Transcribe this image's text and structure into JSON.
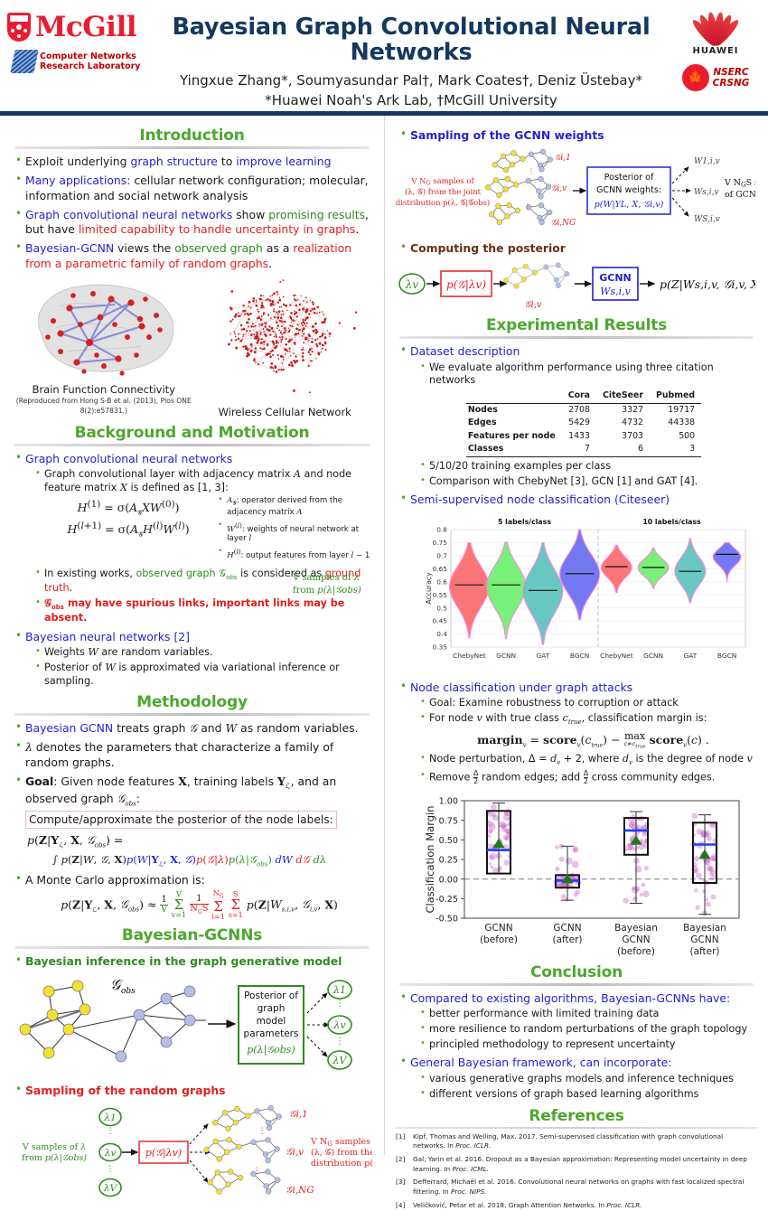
{
  "header": {
    "title": "Bayesian Graph Convolutional Neural Networks",
    "authors": "Yingxue Zhang*, Soumyasundar Pal†, Mark Coates†, Deniz Üstebay*",
    "affiliations": "*Huawei Noah's Ark Lab, †McGill University",
    "logo_mcgill": "McGill",
    "logo_cnrl_line1": "Computer Networks",
    "logo_cnrl_line2": "Research Laboratory",
    "logo_huawei": "HUAWEI",
    "logo_nserc_line1": "NSERC",
    "logo_nserc_line2": "CRSNG"
  },
  "introduction": {
    "heading": "Introduction",
    "bullets": [
      "Exploit underlying graph structure to improve learning",
      "Many applications: cellular network configuration; molecular, information and social network analysis",
      "Graph convolutional neural networks show promising results, but have limited capability to handle uncertainty in graphs.",
      "Bayesian-GCNN views the observed graph as a realization from a parametric family of random graphs."
    ],
    "figure_left_caption": "Brain Function Connectivity",
    "figure_left_subcaption": "(Reproduced from Hong S-B et al. (2013), Plos ONE 8(2):e57831.)",
    "figure_right_caption": "Wireless Cellular Network"
  },
  "background": {
    "heading": "Background and Motivation",
    "b1": "Graph convolutional neural networks",
    "b1s1": "Graph convolutional layer with adjacency matrix A and node feature matrix X is defined as [1, 3]:",
    "eq1": "H(1) = σ(A_G X W(0))",
    "eq2": "H(l+1) = σ(A_G H(l) W(l))",
    "legend": [
      "A_G: operator derived from the adjacency matrix A",
      "W(l): weights of neural network at layer l",
      "H(l): output features from layer l − 1"
    ],
    "b1s2": "In existing works, observed graph G_obs is considered as ground truth.",
    "b1s3": "G_obs may have spurious links, important links may be absent.",
    "b2": "Bayesian neural networks [2]",
    "b2s1": "Weights W are random variables.",
    "b2s2": "Posterior of W is approximated via variational inference or sampling."
  },
  "methodology": {
    "heading": "Methodology",
    "b1": "Bayesian GCNN treats graph G and W as random variables.",
    "b2": "λ denotes the parameters that characterize a family of random graphs.",
    "b3": "Goal: Given node features X, training labels Y_L, and an observed graph G_obs:",
    "notebox": "Compute/approximate the posterior of the node labels:",
    "eq_lhs": "p(Z|Y_L, X, G_obs) =",
    "eq_rhs": "∫ p(Z|W, G, X)p(W|Y_L, X, G)p(G|λ)p(λ|G_obs) dW dG dλ",
    "b4": "A Monte Carlo approximation is:",
    "eq_mc": "p(Z|Y_L, X, G_obs) ≈ (1/V) Σ_{v=1}^{V} (1/(N_G S)) Σ_{i=1}^{N_G} Σ_{s=1}^{S} p(Z|W_{s,i,v}, G_{i,v}, X)"
  },
  "bayesian_gcnns": {
    "heading": "Bayesian-GCNNs",
    "b1": "Bayesian inference in the graph generative model",
    "diagram1": {
      "graph_label": "G_obs",
      "box_lines": [
        "Posterior of",
        "graph",
        "model",
        "parameters",
        "p(λ|G_obs)"
      ],
      "lambda_nodes": [
        "λ1",
        "λv",
        "λV"
      ],
      "right_text_line1": "V samples of λ",
      "right_text_line2": "from p(λ|G_obs)"
    },
    "b2": "Sampling of the random graphs",
    "diagram2": {
      "left_text_line1": "V samples of λ",
      "left_text_line2": "from p(λ|G_obs)",
      "lambda_nodes": [
        "λ1",
        "λv",
        "λV"
      ],
      "box": "p(G|λv)",
      "graph_labels": [
        "G_i,1",
        "G_i,v",
        "G_i,N_G"
      ],
      "right_text_line1": "V N_G samples of",
      "right_text_line2": "(λ, G) from the joint",
      "right_text_line3": "distribution p(λ, G|G_obs)"
    },
    "b3": "Sampling of the GCNN weights",
    "diagram3": {
      "left_text_line1": "V N_G samples of",
      "left_text_line2": "(λ, G) from the joint",
      "left_text_line3": "distribution p(λ, G|G_obs)",
      "graph_labels": [
        "G_i,1",
        "G_i,v",
        "G_i,N_G"
      ],
      "box_lines": [
        "Posterior of",
        "GCNN weights:",
        "p(W|Y_L, X, G_i,v)"
      ],
      "w_labels": [
        "W_1,i,v",
        "W_s,i,v",
        "W_S,i,v"
      ],
      "right_text_line1": "V N_G S samples",
      "right_text_line2": "of GCNN weights"
    },
    "b4": "Computing the posterior",
    "diagram4": {
      "lambda": "λv",
      "box1": "p(G|λv)",
      "graph_label": "G_i,v",
      "box2_line1": "GCNN",
      "box2_line2": "W_s,i,v",
      "output": "p(Z|W_s,i,v, G_i,v, X)"
    }
  },
  "experimental": {
    "heading": "Experimental Results",
    "b1": "Dataset description",
    "b1s1": "We evaluate algorithm performance using three citation networks",
    "b1s2": "5/10/20 training examples per class",
    "b1s3": "Comparison with ChebyNet [3], GCN [1] and GAT [4].",
    "b2": "Semi-supervised node classification (Citeseer)",
    "b3": "Node classification under graph attacks",
    "b3s1": "Goal: Examine robustness to corruption or attack",
    "b3s2": "For node v with true class c_true, classification margin is:",
    "eq_margin": "margin_v = score_v(c_true) − max_{c≠c_true} score_v(c) .",
    "b3s3": "Node perturbation, Δ = d_v + 2, where d_v is the degree of node v",
    "b3s4": "Remove Δ/2 random edges; add Δ/2 cross community edges."
  },
  "dataset_table": {
    "columns": [
      "",
      "Cora",
      "CiteSeer",
      "Pubmed"
    ],
    "rows": [
      {
        "label": "Nodes",
        "values": [
          "2708",
          "3327",
          "19717"
        ]
      },
      {
        "label": "Edges",
        "values": [
          "5429",
          "4732",
          "44338"
        ]
      },
      {
        "label": "Features per node",
        "values": [
          "1433",
          "3703",
          "500"
        ]
      },
      {
        "label": "Classes",
        "values": [
          "7",
          "6",
          "3"
        ]
      }
    ]
  },
  "conclusion": {
    "heading": "Conclusion",
    "b1": "Compared to existing algorithms, Bayesian-GCNNs have:",
    "b1subs": [
      "better performance with limited training data",
      "more resilience to random perturbations of the graph topology",
      "principled methodology to represent uncertainty"
    ],
    "b2": "General Bayesian framework, can incorporate:",
    "b2subs": [
      "various generative graphs models and inference techniques",
      "different versions of graph based learning algorithms"
    ]
  },
  "references": {
    "heading": "References",
    "items": [
      {
        "num": "[1]",
        "text": "Kipf, Thomas and Welling, Max. 2017. Semi-supervised classification with graph convolutional networks. In ",
        "venue": "Proc. ICLR."
      },
      {
        "num": "[2]",
        "text": "Gal, Yarin et al. 2016. Dropout as a Bayesian approximation: Representing model uncertainty in deep learning. In ",
        "venue": "Proc. ICML."
      },
      {
        "num": "[3]",
        "text": "Defferrard, Michaël et al. 2016. Convolutional neural networks on graphs with fast localized spectral filtering. In ",
        "venue": "Proc. NIPS."
      },
      {
        "num": "[4]",
        "text": "Veličković, Petar et al. 2018. Graph Attention Networks. In ",
        "venue": "Proc. ICLR."
      }
    ]
  },
  "chart_data": [
    {
      "type": "violin",
      "title": "Semi-supervised node classification (Citeseer)",
      "ylabel": "Accuracy",
      "xlabel": "",
      "ylim": [
        0.35,
        0.8
      ],
      "yticks": [
        0.35,
        0.4,
        0.45,
        0.5,
        0.55,
        0.6,
        0.65,
        0.7,
        0.75,
        0.8
      ],
      "group_labels": [
        "5 labels/class",
        "10 labels/class"
      ],
      "categories": [
        "ChebyNet",
        "GCNN",
        "GAT",
        "BGCN",
        "ChebyNet",
        "GCNN",
        "GAT",
        "BGCN"
      ],
      "colors": [
        "#fa6a6a",
        "#6ef06e",
        "#5cc3bd",
        "#6a6ef0",
        "#fa6a6a",
        "#6ef06e",
        "#5cc3bd",
        "#6a6ef0"
      ],
      "series": [
        {
          "name": "median",
          "values": [
            0.588,
            0.588,
            0.567,
            0.631,
            0.658,
            0.655,
            0.64,
            0.705
          ]
        },
        {
          "name": "min",
          "values": [
            0.385,
            0.383,
            0.36,
            0.455,
            0.558,
            0.575,
            0.52,
            0.6
          ]
        },
        {
          "name": "max",
          "values": [
            0.75,
            0.752,
            0.75,
            0.8,
            0.74,
            0.73,
            0.765,
            0.75
          ]
        }
      ]
    },
    {
      "type": "box",
      "title": "Node classification under graph attacks",
      "ylabel": "Classification Margin",
      "xlabel": "",
      "ylim": [
        -0.5,
        1.0
      ],
      "yticks": [
        -0.5,
        -0.25,
        0.0,
        0.25,
        0.5,
        0.75,
        1.0
      ],
      "zero_line": 0.0,
      "categories": [
        "GCNN\n(before)",
        "GCNN\n(after)",
        "Bayesian\nGCNN\n(before)",
        "Bayesian\nGCNN\n(after)"
      ],
      "boxes": [
        {
          "q1": 0.07,
          "median": 0.37,
          "q3": 0.87,
          "mean": 0.45,
          "whisker_low": 0.07,
          "whisker_high": 0.97
        },
        {
          "q1": -0.11,
          "median": -0.02,
          "q3": 0.05,
          "mean": 0.0,
          "whisker_low": -0.27,
          "whisker_high": 0.42
        },
        {
          "q1": 0.31,
          "median": 0.62,
          "q3": 0.78,
          "mean": 0.49,
          "whisker_low": -0.31,
          "whisker_high": 0.86
        },
        {
          "q1": -0.05,
          "median": 0.44,
          "q3": 0.72,
          "mean": 0.31,
          "whisker_low": -0.45,
          "whisker_high": 0.82
        }
      ],
      "mean_marker_color": "#1a7a1a",
      "median_line_color": "#1f3fff",
      "point_color": "#cc66cc"
    }
  ]
}
